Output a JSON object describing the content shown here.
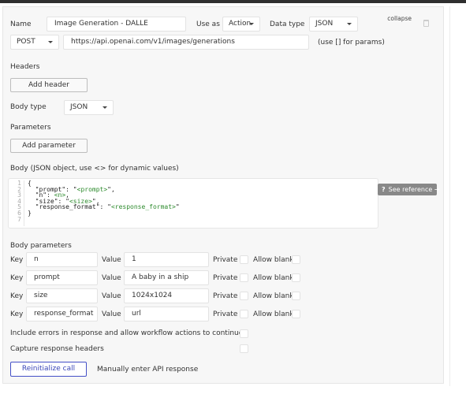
{
  "panel": {
    "collapse_label": "collapse",
    "delete_icon": "trash-icon"
  },
  "call": {
    "name_label": "Name",
    "name_value": "Image Generation - DALLE",
    "use_as_label": "Use as",
    "use_as_value": "Action",
    "data_type_label": "Data type",
    "data_type_value": "JSON",
    "method_value": "POST",
    "url_value": "https://api.openai.com/v1/images/generations",
    "url_hint": "(use [] for params)"
  },
  "headers": {
    "section_label": "Headers",
    "add_button": "Add header"
  },
  "body_type": {
    "label": "Body type",
    "value": "JSON"
  },
  "parameters": {
    "section_label": "Parameters",
    "add_button": "Add parameter"
  },
  "body": {
    "label": "Body (JSON object, use <> for dynamic values)",
    "line_numbers": [
      "1",
      "2",
      "3",
      "4",
      "5",
      "6",
      "7"
    ],
    "lines": [
      "{",
      "  \"prompt\": \"<prompt>\",",
      "  \"n\": <n>,",
      "  \"size\": \"<size>\",",
      "  \"response_format\": \"<response_format>\"",
      "}",
      ""
    ],
    "reference_button": "See reference →",
    "reference_icon": "?"
  },
  "body_parameters": {
    "section_label": "Body parameters",
    "key_label": "Key",
    "value_label": "Value",
    "private_label": "Private",
    "allow_blank_label": "Allow blank",
    "rows": [
      {
        "key": "n",
        "value": "1",
        "private": false,
        "allow_blank": false
      },
      {
        "key": "prompt",
        "value": "A baby in a ship",
        "private": false,
        "allow_blank": false
      },
      {
        "key": "size",
        "value": "1024x1024",
        "private": false,
        "allow_blank": false
      },
      {
        "key": "response_format",
        "value": "url",
        "private": false,
        "allow_blank": false
      }
    ]
  },
  "options": {
    "include_errors_label": "Include errors in response and allow workflow actions to continue",
    "include_errors_checked": false,
    "capture_headers_label": "Capture response headers",
    "capture_headers_checked": false
  },
  "footer": {
    "reinitialize_button": "Reinitialize call",
    "manual_link": "Manually enter API response"
  }
}
